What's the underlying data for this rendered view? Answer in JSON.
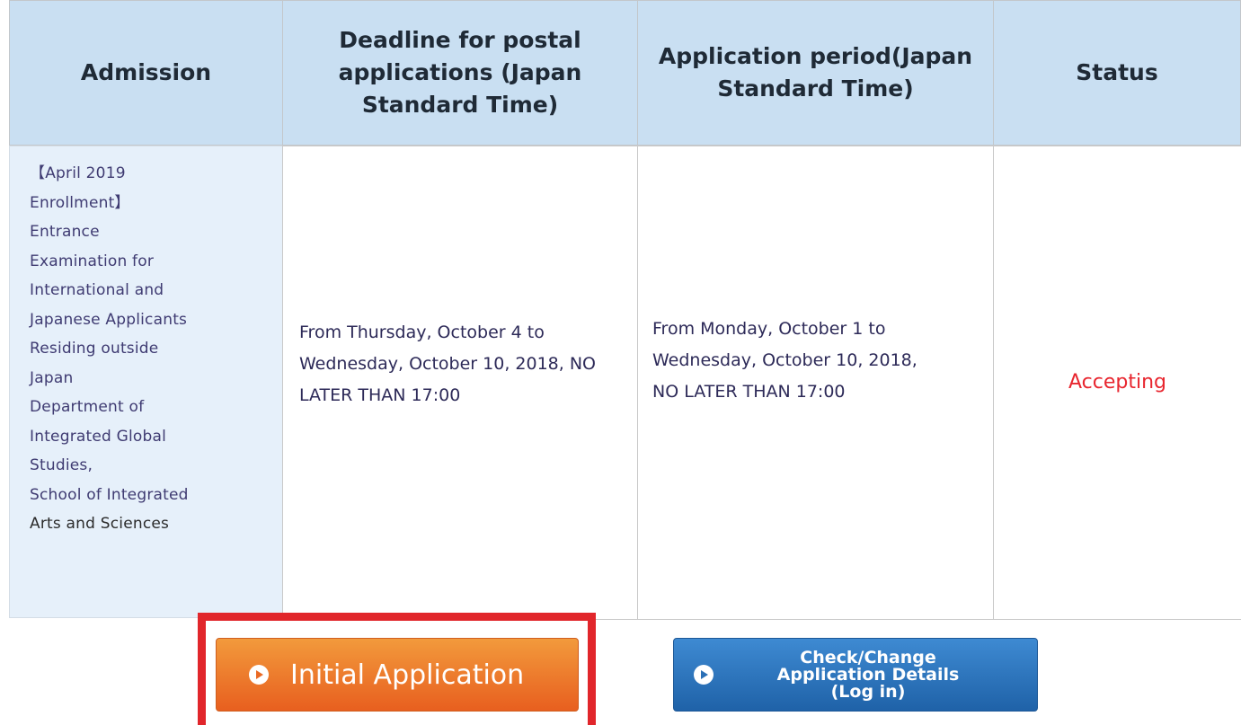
{
  "table": {
    "headers": {
      "admission": "Admission",
      "postal_deadline": "Deadline for postal applications (Japan Standard Time)",
      "application_period": "Application period(Japan Standard Time)",
      "status": "Status"
    },
    "row": {
      "admission_lines": [
        "【April 2019",
        "Enrollment】",
        "Entrance",
        "Examination for",
        "International and",
        "Japanese Applicants",
        "Residing outside",
        "Japan",
        "Department of",
        "Integrated Global",
        "Studies,",
        "School of Integrated",
        "Arts and Sciences"
      ],
      "postal_deadline": "From Thursday, October 4 to Wednesday, October 10, 2018, NO LATER THAN 17:00",
      "application_period": "From Monday, October 1 to Wednesday, October 10, 2018, NO LATER THAN 17:00",
      "status": "Accepting"
    }
  },
  "buttons": {
    "initial": "Initial Application",
    "check_change": "Check/Change\nApplication Details\n(Log in)"
  },
  "colors": {
    "header_bg": "#c9dff2",
    "status_accepting": "#e8262f",
    "initial_button": "#ee7a2c",
    "check_button": "#2a6fb6",
    "highlight_box": "#e1262b"
  }
}
